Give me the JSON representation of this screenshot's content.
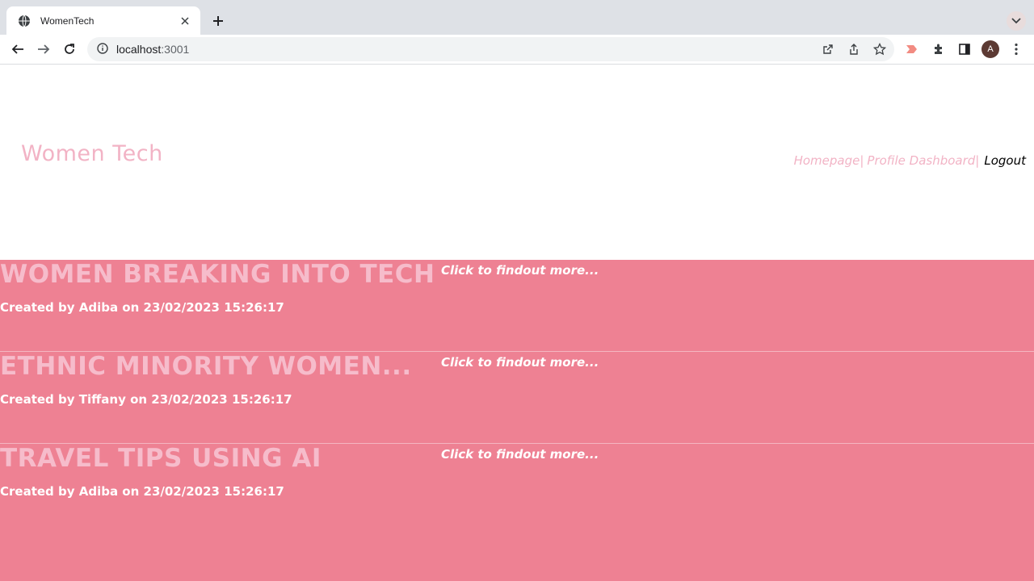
{
  "browser": {
    "tab_title": "WomenTech",
    "url_host": "localhost",
    "url_port": ":3001",
    "profile_initial": "A"
  },
  "site": {
    "brand": "Women Tech",
    "nav": {
      "homepage": "Homepage|",
      "dashboard": "Profile Dashboard|",
      "logout": "Logout"
    }
  },
  "posts": [
    {
      "title": "WOMEN BREAKING INTO TECH",
      "meta": "Created by Adiba on 23/02/2023 15:26:17",
      "more": "Click to findout more..."
    },
    {
      "title": "ETHNIC MINORITY WOMEN...",
      "meta": "Created by Tiffany on 23/02/2023 15:26:17",
      "more": "Click to findout more..."
    },
    {
      "title": "TRAVEL TIPS USING AI",
      "meta": "Created by Adiba on 23/02/2023 15:26:17",
      "more": "Click to findout more..."
    }
  ],
  "colors": {
    "accent_pink": "#f2b3c5",
    "post_background": "#ee8193"
  }
}
